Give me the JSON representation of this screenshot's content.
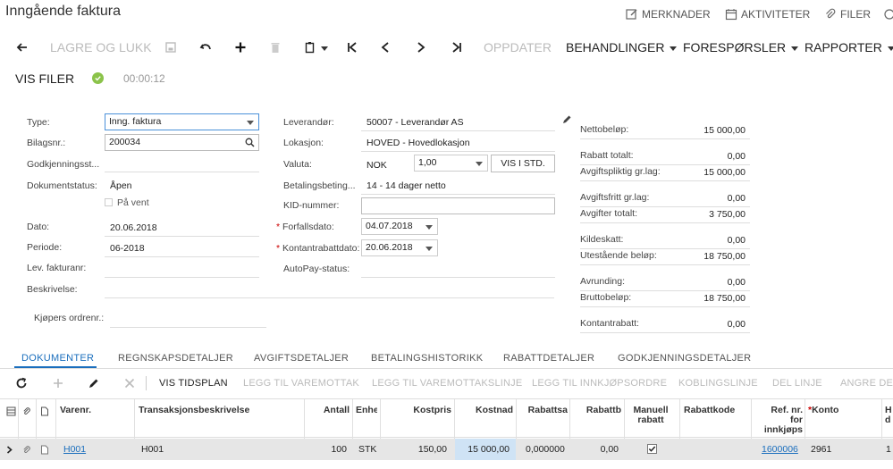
{
  "header": {
    "title": "Inngående faktura",
    "links": {
      "notes": "MERKNADER",
      "activities": "AKTIVITETER",
      "files": "FILER"
    }
  },
  "toolbar": {
    "save_close": "LAGRE OG LUKK",
    "update": "OPPDATER",
    "menus": {
      "actions": "BEHANDLINGER",
      "inquiries": "FORESPØRSLER",
      "reports": "RAPPORTER"
    },
    "show_files": "VIS FILER",
    "timer": "00:00:12"
  },
  "form": {
    "left": {
      "type_label": "Type:",
      "type_value": "Inng. faktura",
      "doc_no_label": "Bilagsnr.:",
      "doc_no_value": "200034",
      "approval_label": "Godkjenningsst...",
      "status_label": "Dokumentstatus:",
      "status_value": "Åpen",
      "on_hold_label": "På vent",
      "date_label": "Dato:",
      "date_value": "20.06.2018",
      "period_label": "Periode:",
      "period_value": "06-2018",
      "vendor_ref_label": "Lev. fakturanr:",
      "description_label": "Beskrivelse:",
      "buyer_order_label": "Kjøpers ordrenr.:"
    },
    "middle": {
      "vendor_label": "Leverandør:",
      "vendor_value": "50007 - Leverandør AS",
      "location_label": "Lokasjon:",
      "location_value": "HOVED - Hovedlokasjon",
      "currency_label": "Valuta:",
      "currency_value": "NOK",
      "rate_value": "1,00",
      "view_base_button": "VIS I STD.",
      "terms_label": "Betalingsbeting...",
      "terms_value": "14 - 14 dager netto",
      "kid_label": "KID-nummer:",
      "due_date_label": "Forfallsdato:",
      "due_date_value": "04.07.2018",
      "cash_discount_date_label": "Kontantrabattdato:",
      "cash_discount_date_value": "20.06.2018",
      "autopay_label": "AutoPay-status:"
    },
    "summary": [
      {
        "label": "Nettobeløp:",
        "value": "15 000,00"
      },
      {
        "label": "Rabatt totalt:",
        "value": "0,00"
      },
      {
        "label": "Avgiftspliktig gr.lag:",
        "value": "15 000,00"
      },
      {
        "label": "Avgiftsfritt gr.lag:",
        "value": "0,00"
      },
      {
        "label": "Avgifter totalt:",
        "value": "3 750,00"
      },
      {
        "label": "Kildeskatt:",
        "value": "0,00"
      },
      {
        "label": "Utestående beløp:",
        "value": "18 750,00"
      },
      {
        "label": "Avrunding:",
        "value": "0,00"
      },
      {
        "label": "Bruttobeløp:",
        "value": "18 750,00"
      },
      {
        "label": "Kontantrabatt:",
        "value": "0,00"
      }
    ]
  },
  "tabs": [
    "DOKUMENTER",
    "REGNSKAPSDETALJER",
    "AVGIFTSDETALJER",
    "BETALINGSHISTORIKK",
    "RABATTDETALJER",
    "GODKJENNINGSDETALJER"
  ],
  "grid_toolbar": {
    "schedule": "VIS TIDSPLAN",
    "add_receipt": "LEGG TIL VAREMOTTAK",
    "add_receipt_line": "LEGG TIL VAREMOTTAKSLINJE",
    "add_po": "LEGG TIL INNKJØPSORDRE",
    "link_line": "KOBLINGSLINJE",
    "split_line": "DEL LINJE",
    "undo_split": "ANGRE DEL"
  },
  "grid": {
    "columns": {
      "item": "Varenr.",
      "desc": "Transaksjonsbeskrivelse",
      "qty": "Antall",
      "uom": "Enhe",
      "unit_cost": "Kostpris",
      "ext_cost": "Kostnad",
      "disc_pct": "Rabattsa",
      "disc_amt": "Rabattb",
      "manual_disc_1": "Manuell",
      "manual_disc_2": "rabatt",
      "disc_code": "Rabattkode",
      "po_ref_1": "Ref. nr.",
      "po_ref_2": "for",
      "po_ref_3": "innkjøps",
      "account": "Konto",
      "h1": "H",
      "h2": "d"
    },
    "rows": [
      {
        "item": "H001",
        "desc": "H001",
        "qty": "100",
        "uom": "STK",
        "unit_cost": "150,00",
        "ext_cost": "15 000,00",
        "disc_pct": "0,000000",
        "disc_amt": "0,00",
        "manual_disc": true,
        "disc_code": "",
        "po_ref": "1600006",
        "account": "2961",
        "h": "1"
      }
    ]
  }
}
